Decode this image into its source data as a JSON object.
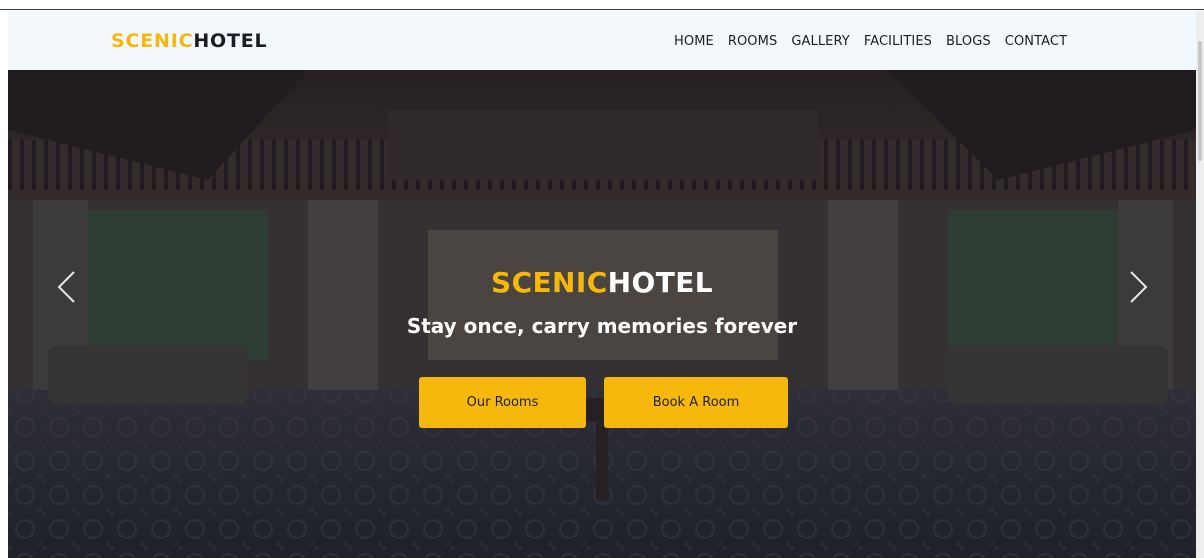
{
  "brand": {
    "part1": "SCENIC",
    "part2": "HOTEL",
    "accent_color": "#f6b80d",
    "dark_color": "#1c1d22"
  },
  "nav": {
    "items": [
      {
        "label": "HOME"
      },
      {
        "label": "ROOMS"
      },
      {
        "label": "GALLERY"
      },
      {
        "label": "FACILITIES"
      },
      {
        "label": "BLOGS"
      },
      {
        "label": "CONTACT"
      }
    ]
  },
  "hero": {
    "title_part1": "SCENIC",
    "title_part2": "HOTEL",
    "subtitle": "Stay once, carry memories forever",
    "buttons": {
      "rooms": "Our Rooms",
      "book": "Book A Room"
    },
    "prev_icon": "chevron-left-icon",
    "next_icon": "chevron-right-icon",
    "background": "hotel-lobby-photo"
  },
  "colors": {
    "nav_bg": "#f3f8fd",
    "button_bg": "#f6b80d"
  }
}
